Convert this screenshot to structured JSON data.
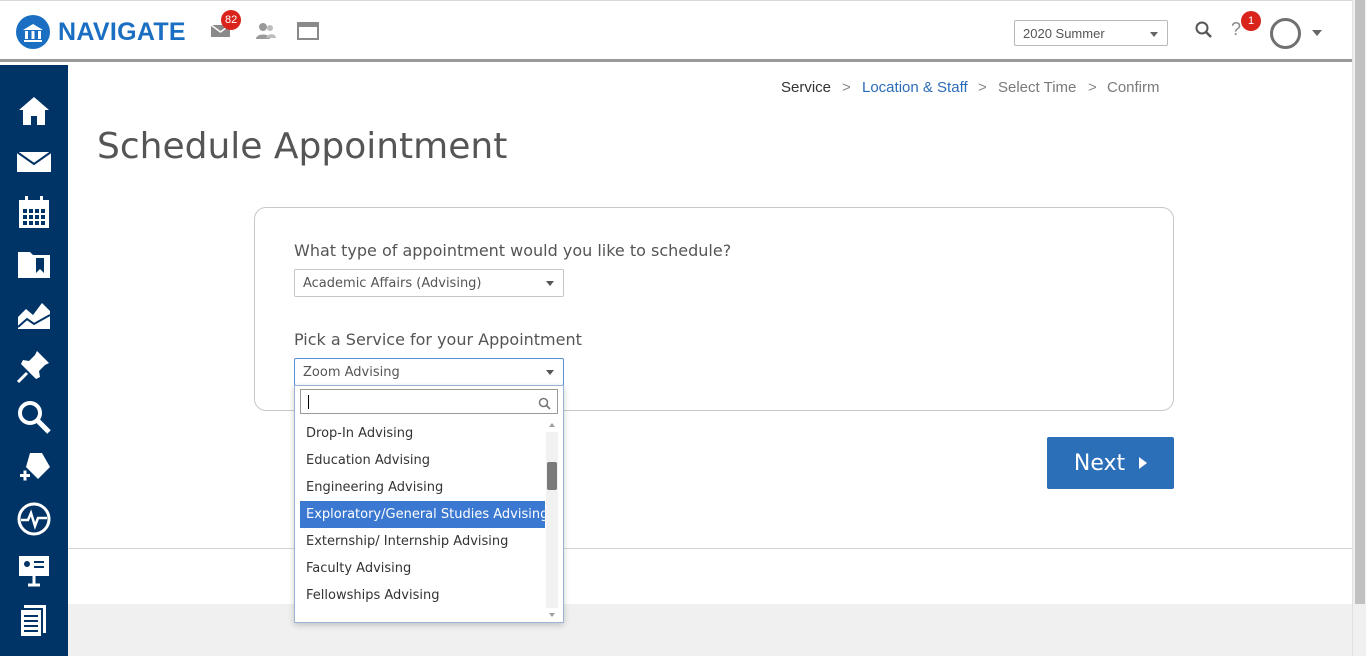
{
  "app": {
    "name": "NAVIGATE",
    "brand_color": "#1b6fc2"
  },
  "topbar": {
    "mail_badge": "82",
    "term_selected": "2020 Summer",
    "help_badge": "1",
    "help_icon_text": "?"
  },
  "sidebar": {
    "items": [
      {
        "icon": "home-icon"
      },
      {
        "icon": "mail-icon"
      },
      {
        "icon": "calendar-icon"
      },
      {
        "icon": "folder-bookmark-icon"
      },
      {
        "icon": "area-chart-icon"
      },
      {
        "icon": "pin-icon"
      },
      {
        "icon": "search-icon"
      },
      {
        "icon": "tag-plus-icon"
      },
      {
        "icon": "pulse-icon"
      },
      {
        "icon": "presentation-icon"
      },
      {
        "icon": "documents-icon"
      }
    ],
    "color": "#003366"
  },
  "breadcrumb": {
    "steps": [
      "Service",
      "Location & Staff",
      "Select Time",
      "Confirm"
    ],
    "separator": ">"
  },
  "page": {
    "title": "Schedule Appointment"
  },
  "form": {
    "appointment_type_label": "What type of appointment would you like to schedule?",
    "appointment_type_value": "Academic Affairs (Advising)",
    "service_label": "Pick a Service for your Appointment",
    "service_value": "Zoom Advising"
  },
  "dropdown": {
    "search_value": "",
    "options": [
      "Drop-In Advising",
      "Education Advising",
      "Engineering Advising",
      "Exploratory/General Studies Advising",
      "Externship/ Internship Advising",
      "Faculty Advising",
      "Fellowships Advising"
    ],
    "highlighted": "Exploratory/General Studies Advising"
  },
  "actions": {
    "next_label": "Next"
  }
}
